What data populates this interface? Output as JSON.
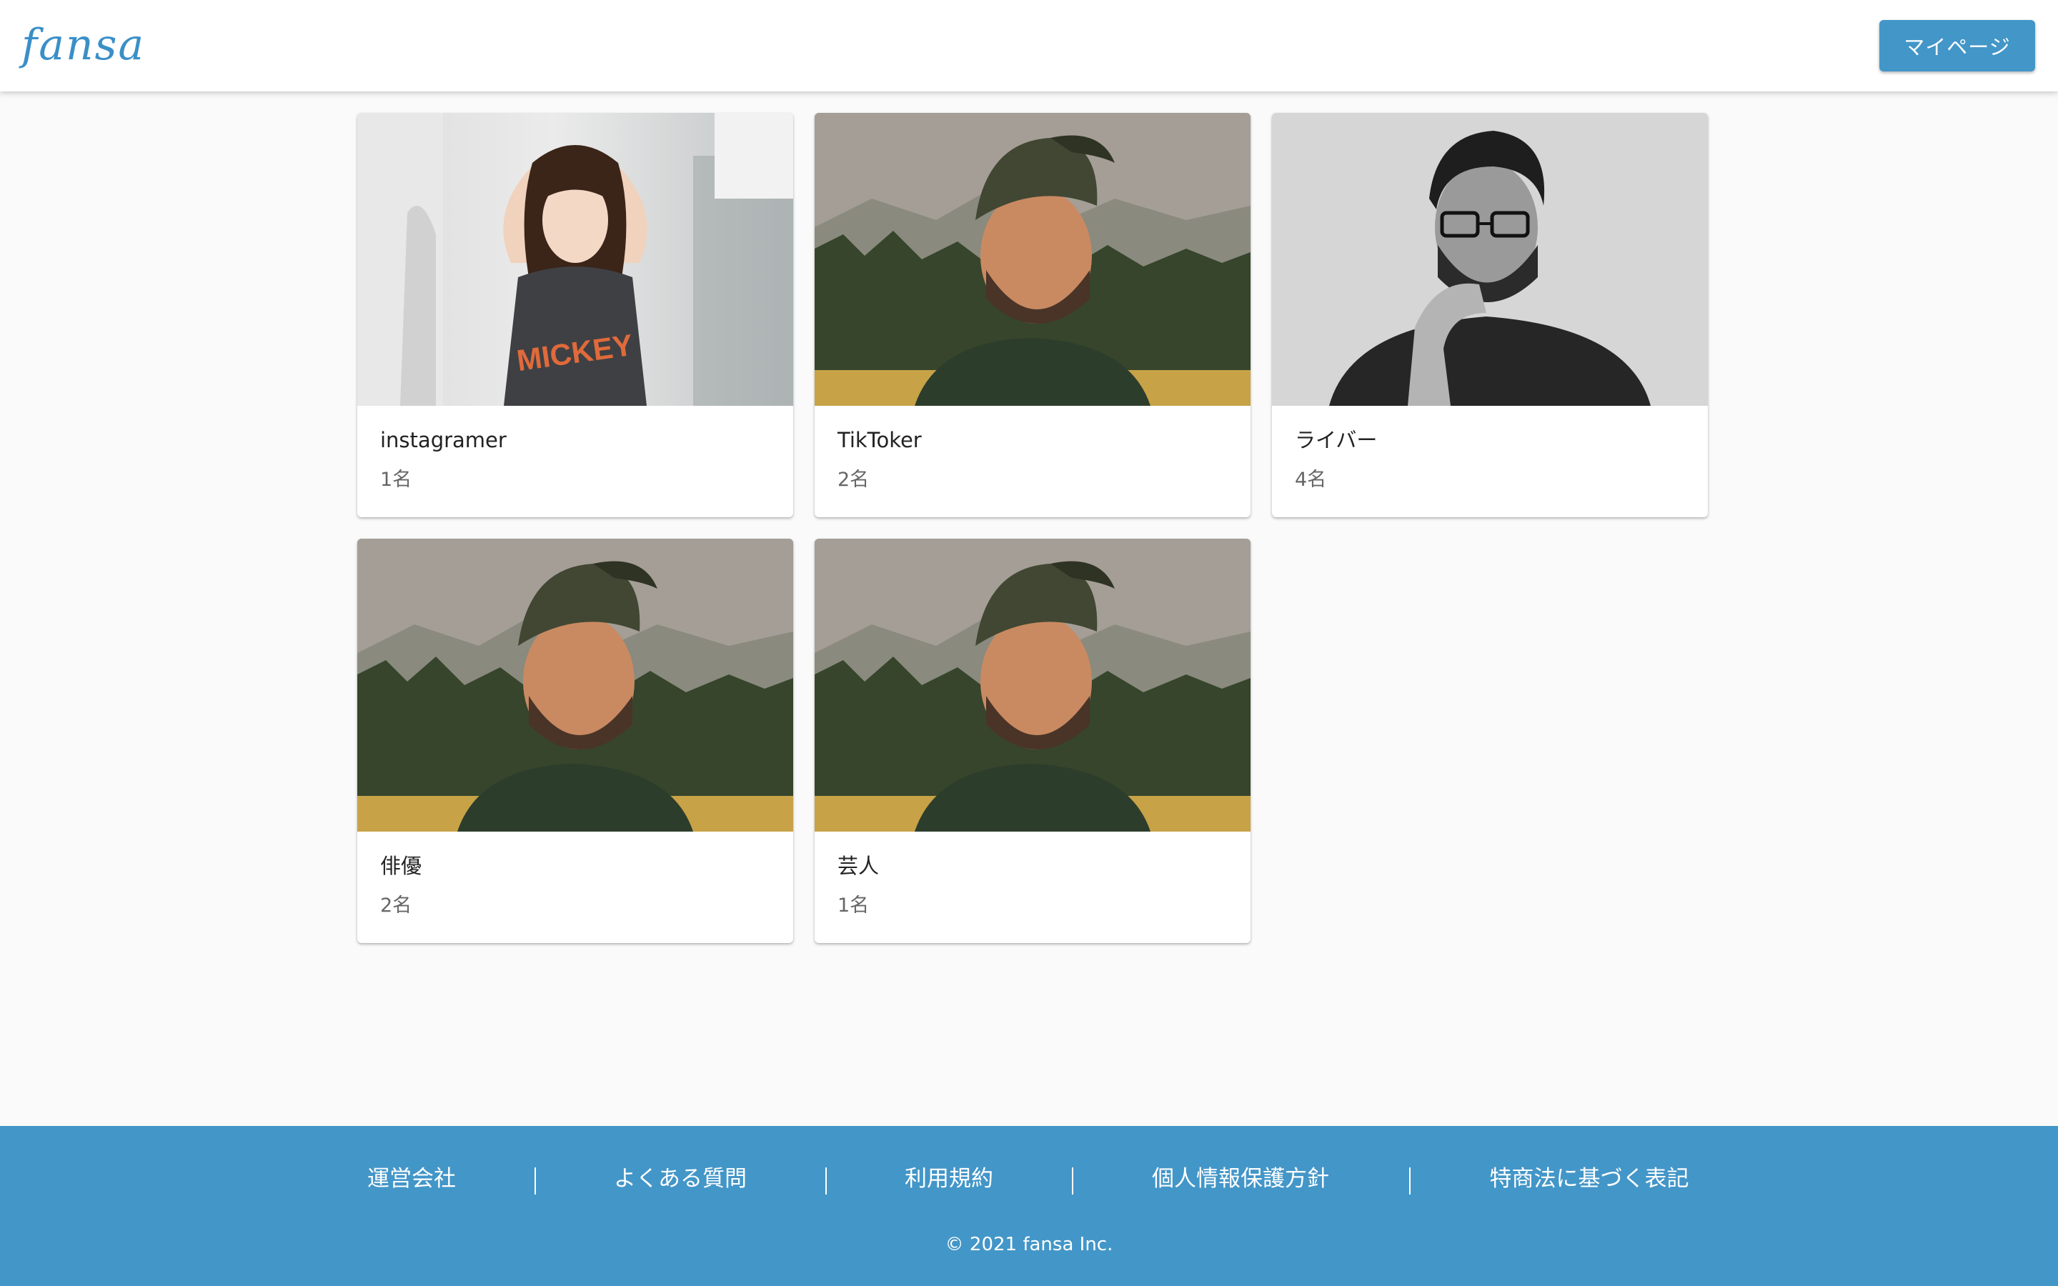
{
  "header": {
    "logo": "fansa",
    "mypage_label": "マイページ"
  },
  "cards": [
    {
      "title": "instagramer",
      "count": "1名",
      "image": "woman-portrait-photo"
    },
    {
      "title": "TikToker",
      "count": "2名",
      "image": "man-cap-mountain-photo"
    },
    {
      "title": "ライバー",
      "count": "4名",
      "image": "man-glasses-bw-photo"
    },
    {
      "title": "俳優",
      "count": "2名",
      "image": "man-cap-mountain-photo"
    },
    {
      "title": "芸人",
      "count": "1名",
      "image": "man-cap-mountain-photo"
    }
  ],
  "footer": {
    "links": [
      "運営会社",
      "よくある質問",
      "利用規約",
      "個人情報保護方針",
      "特商法に基づく表記"
    ],
    "separator": "|",
    "copyright": "© 2021 fansa Inc."
  },
  "colors": {
    "accent": "#4396c8",
    "background": "#fafafa",
    "card": "#ffffff"
  }
}
